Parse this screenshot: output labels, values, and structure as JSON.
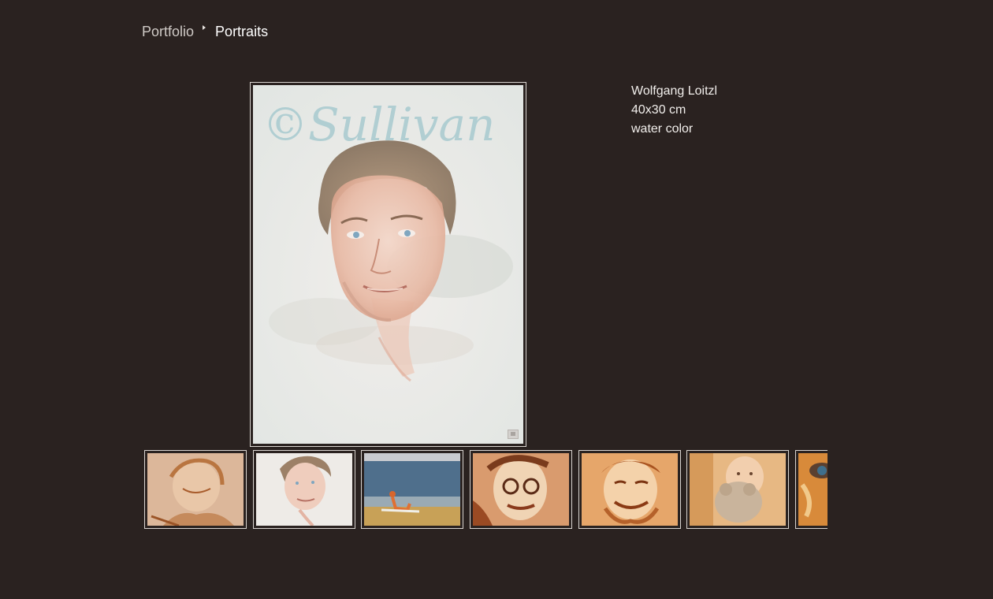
{
  "breadcrumb": {
    "parent": "Portfolio",
    "current": "Portraits"
  },
  "artwork": {
    "title": "Wolfgang Loitzl",
    "size": "40x30 cm",
    "medium": "water color",
    "watermark": "©Sullivan"
  },
  "thumbnails": [
    {
      "subject": "elderly woman portrait"
    },
    {
      "subject": "young man portrait"
    },
    {
      "subject": "figure on beach"
    },
    {
      "subject": "man with glasses portrait"
    },
    {
      "subject": "smiling man portrait"
    },
    {
      "subject": "child with teddy bear"
    },
    {
      "subject": "close-up face portrait"
    }
  ],
  "colors": {
    "background": "#2a2220",
    "frame": "#d9d4d0",
    "text": "#f2efec"
  }
}
